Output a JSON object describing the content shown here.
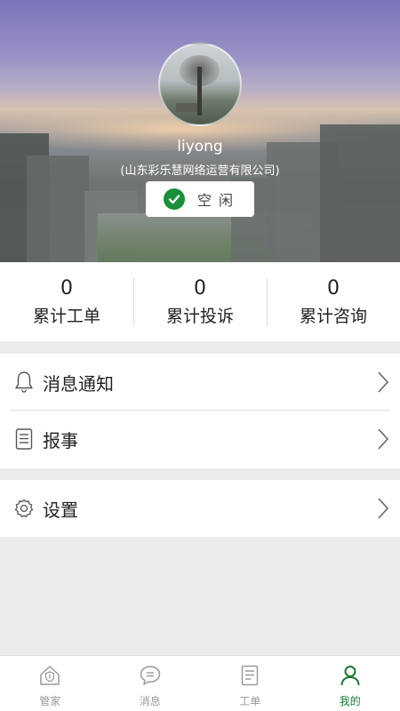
{
  "profile": {
    "username": "liyong",
    "company": "(山东彩乐慧网络运营有限公司)",
    "status": "空闲"
  },
  "stats": [
    {
      "value": "0",
      "label": "累计工单"
    },
    {
      "value": "0",
      "label": "累计投诉"
    },
    {
      "value": "0",
      "label": "累计咨询"
    }
  ],
  "menu": {
    "notifications": {
      "label": "消息通知",
      "icon": "bell-icon"
    },
    "report": {
      "label": "报事",
      "icon": "document-icon"
    },
    "settings": {
      "label": "设置",
      "icon": "gear-icon"
    }
  },
  "tabbar": [
    {
      "label": "管家",
      "icon": "house-shield-icon",
      "active": false
    },
    {
      "label": "消息",
      "icon": "chat-bubble-icon",
      "active": false
    },
    {
      "label": "工单",
      "icon": "worksheet-icon",
      "active": false
    },
    {
      "label": "我的",
      "icon": "person-icon",
      "active": true
    }
  ],
  "colors": {
    "accent": "#1a7a32",
    "status_check": "#1a8f3c",
    "background": "#ececec"
  }
}
